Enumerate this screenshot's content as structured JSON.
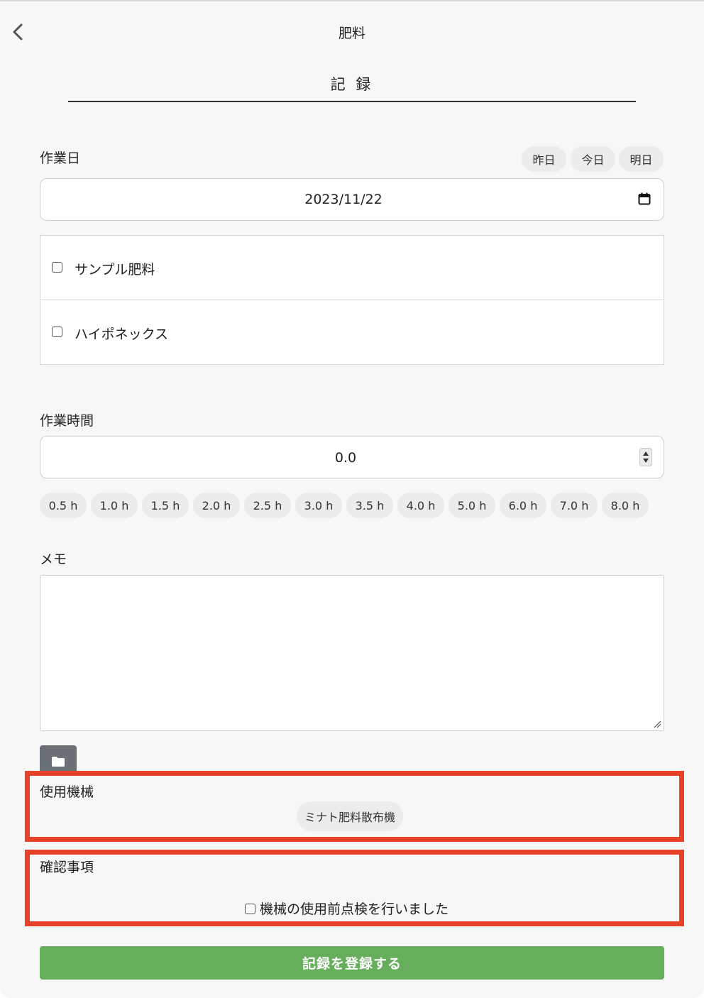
{
  "header": {
    "title": "肥料",
    "back_icon": "chevron-left-icon"
  },
  "tab": {
    "label": "記 録"
  },
  "work_date": {
    "label": "作業日",
    "quick_buttons": [
      "昨日",
      "今日",
      "明日"
    ],
    "value": "2023/11/22",
    "calendar_icon": "calendar-icon"
  },
  "fertilizers": [
    {
      "name": "サンプル肥料",
      "checked": false
    },
    {
      "name": "ハイポネックス",
      "checked": false
    }
  ],
  "work_time": {
    "label": "作業時間",
    "value": "0.0",
    "presets": [
      "0.5 h",
      "1.0 h",
      "1.5 h",
      "2.0 h",
      "2.5 h",
      "3.0 h",
      "3.5 h",
      "4.0 h",
      "5.0 h",
      "6.0 h",
      "7.0 h",
      "8.0 h"
    ]
  },
  "memo": {
    "label": "メモ",
    "value": ""
  },
  "attach": {
    "icon": "folder-icon"
  },
  "machinery": {
    "label": "使用機械",
    "items": [
      "ミナト肥料散布機"
    ]
  },
  "confirmation": {
    "label": "確認事項",
    "item": "機械の使用前点検を行いました",
    "checked": false
  },
  "submit": {
    "label": "記録を登録する"
  },
  "colors": {
    "highlight": "#e8412a",
    "submit": "#67ae5c",
    "folder_button": "#6b6f76"
  }
}
